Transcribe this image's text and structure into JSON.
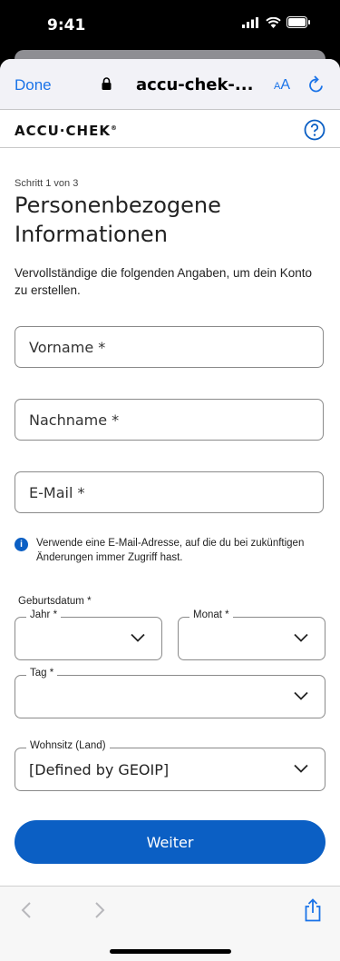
{
  "status_bar": {
    "time": "9:41"
  },
  "browser": {
    "done_label": "Done",
    "url": "accu-chek-...",
    "text_size_label_small": "A",
    "text_size_label_large": "A"
  },
  "brand": {
    "logo": "ACCU·CHEK",
    "trademark": "®"
  },
  "form": {
    "step": "Schritt 1 von 3",
    "title": "Personenbezogene Informationen",
    "intro": "Vervollständige die folgenden Angaben, um dein Konto zu erstellen.",
    "first_name_placeholder": "Vorname *",
    "last_name_placeholder": "Nachname *",
    "email_placeholder": "E-Mail *",
    "email_hint": "Verwende eine E-Mail-Adresse, auf die du bei zukünftigen Änderungen immer Zugriff hast.",
    "dob_label": "Geburtsdatum *",
    "year_label": "Jahr *",
    "month_label": "Monat *",
    "day_label": "Tag *",
    "country_label": "Wohnsitz (Land)",
    "country_value": "[Defined by GEOIP]",
    "next_label": "Weiter"
  },
  "colors": {
    "accent": "#0b5fc4",
    "link": "#1a73e8"
  }
}
